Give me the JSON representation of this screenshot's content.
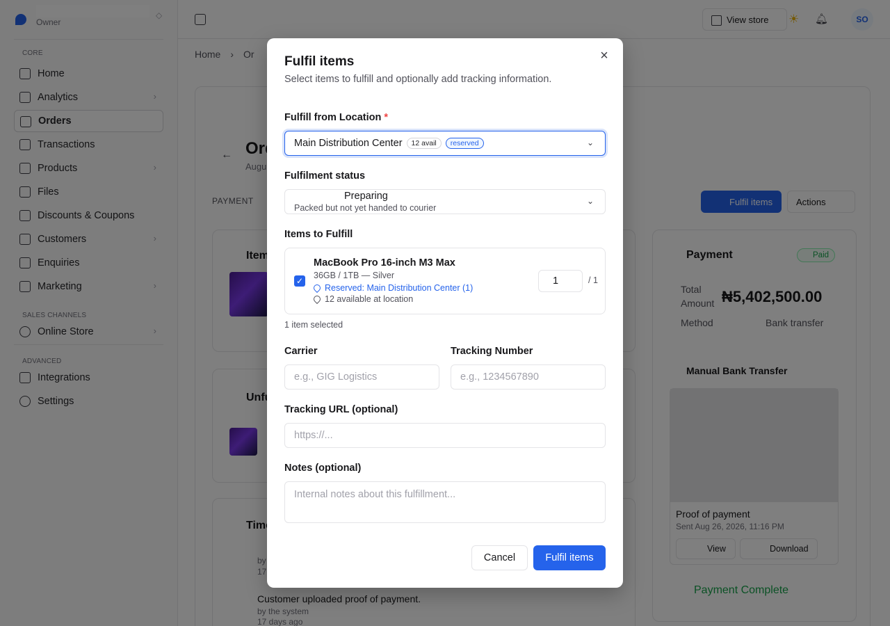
{
  "brand": {
    "role": "Owner"
  },
  "sidebar": {
    "sections": {
      "core": "CORE",
      "sales_channels": "SALES CHANNELS",
      "advanced": "ADVANCED"
    },
    "items": [
      {
        "label": "Home"
      },
      {
        "label": "Analytics"
      },
      {
        "label": "Orders"
      },
      {
        "label": "Transactions"
      },
      {
        "label": "Products"
      },
      {
        "label": "Files"
      },
      {
        "label": "Discounts & Coupons"
      },
      {
        "label": "Customers"
      },
      {
        "label": "Enquiries"
      },
      {
        "label": "Marketing"
      },
      {
        "label": "Online Store"
      },
      {
        "label": "Integrations"
      },
      {
        "label": "Settings"
      }
    ]
  },
  "topbar": {
    "view_store": "View store",
    "avatar": "SO"
  },
  "breadcrumb": {
    "home": "Home",
    "orders": "Or"
  },
  "page": {
    "title": "Ord",
    "date": "Augu",
    "payment_label": "PAYMENT",
    "fulfil_button": "Fulfil items",
    "actions_button": "Actions"
  },
  "items_card": {
    "title": "Item"
  },
  "unfulfilled_card": {
    "title": "Unfu"
  },
  "timeline_card": {
    "title": "Time",
    "line1": "by",
    "line2": "17",
    "event": "Customer uploaded proof of payment.",
    "event_by": "by the system",
    "event_time": "17 days ago"
  },
  "payment_card": {
    "title": "Payment",
    "status": "Paid",
    "total_label_1": "Total",
    "total_label_2": "Amount",
    "total": "₦5,402,500.00",
    "method_label": "Method",
    "method": "Bank transfer",
    "manual_title": "Manual Bank Transfer",
    "proof_title": "Proof of payment",
    "proof_sent": "Sent Aug 26, 2026, 11:16 PM",
    "view": "View",
    "download": "Download",
    "complete": "Payment Complete"
  },
  "modal": {
    "title": "Fulfil items",
    "description": "Select items to fulfill and optionally add tracking information.",
    "location_label": "Fulfill from Location",
    "location_required": "*",
    "location_value": "Main Distribution Center",
    "location_avail": "12 avail",
    "location_reserved": "reserved",
    "status_label": "Fulfilment status",
    "status_value": "Preparing",
    "status_desc": "Packed but not yet handed to courier",
    "items_label": "Items to Fulfill",
    "item": {
      "name": "MacBook Pro 16-inch M3 Max",
      "variant": "36GB / 1TB — Silver",
      "reserved": "Reserved: Main Distribution Center (1)",
      "available": "12 available at location",
      "quantity": "1",
      "max": "/ 1",
      "checked": true
    },
    "selected_count": "1 item selected",
    "carrier_label": "Carrier",
    "carrier_placeholder": "e.g., GIG Logistics",
    "tracking_label": "Tracking Number",
    "tracking_placeholder": "e.g., 1234567890",
    "url_label": "Tracking URL (optional)",
    "url_placeholder": "https://...",
    "notes_label": "Notes (optional)",
    "notes_placeholder": "Internal notes about this fulfillment...",
    "cancel": "Cancel",
    "submit": "Fulfil items"
  },
  "colors": {
    "accent": "#2563eb",
    "success": "#16a34a",
    "danger": "#ef4444"
  }
}
